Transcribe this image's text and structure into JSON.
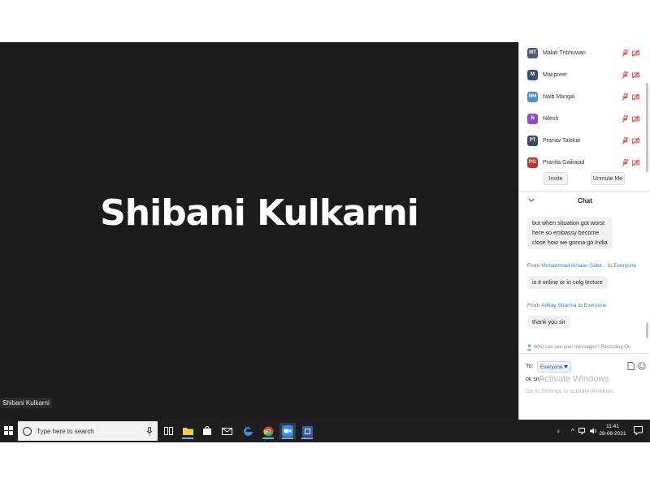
{
  "meeting": {
    "speaker_name": "Shibani Kulkarni",
    "name_tag": "Shibani Kulkarni"
  },
  "participants": [
    {
      "initials": "MT",
      "name": "Malati Tribhuwan",
      "color": "#4a5a78"
    },
    {
      "initials": "M",
      "name": "Manpreet",
      "color": "#3d4f6e"
    },
    {
      "initials": "NM",
      "name": "Naib Mangal",
      "color": "#4a8fd4"
    },
    {
      "initials": "N",
      "name": "Nilesh",
      "color": "#8a4fc6"
    },
    {
      "initials": "PT",
      "name": "Pranav Talekar",
      "color": "#3b4a66"
    },
    {
      "initials": "PG",
      "name": "Pranita Gaikwad",
      "color": "#c0392b"
    }
  ],
  "participant_buttons": {
    "invite": "Invite",
    "unmute_me": "Unmute Me"
  },
  "chat": {
    "title": "Chat",
    "messages": [
      {
        "lines": [
          "but when situation got worst",
          "here so embassy become",
          "close how we gonna go India"
        ]
      },
      {
        "from_name": "Mohammad Arhaan Sabir...",
        "to_word": "to",
        "to_name": "Everyone",
        "from_label": "From",
        "text": "is it online or in colg lecture"
      },
      {
        "from_name": "Abhay Sharma",
        "to_word": "to",
        "to_name": "Everyone",
        "from_label": "From",
        "text": "thank you sir"
      }
    ],
    "privacy_note": "Who can see your messages? Recording On",
    "to_label": "To:",
    "to_value": "Everyone",
    "input_value": "ok sir"
  },
  "watermark": {
    "line1": "Activate Windows",
    "line2": "Go to Settings to activate Windows."
  },
  "taskbar": {
    "search_placeholder": "Type here to search",
    "time": "11:41",
    "date": "28-08-2021"
  },
  "colors": {
    "accent": "#2d7ad6",
    "muted_red": "#e04646",
    "video_bg": "#1c1c1c",
    "taskbar_bg": "#1f1f1f"
  }
}
